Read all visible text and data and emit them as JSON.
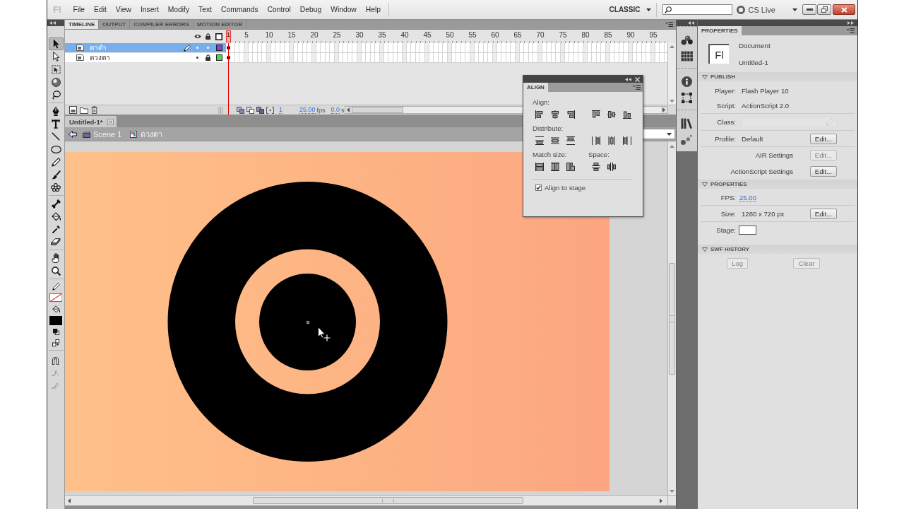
{
  "menu_bar": {
    "logo": "Fl",
    "items": [
      "File",
      "Edit",
      "View",
      "Insert",
      "Modify",
      "Text",
      "Commands",
      "Control",
      "Debug",
      "Window",
      "Help"
    ],
    "workspace": "CLASSIC",
    "cs_live": "CS Live"
  },
  "toolbar": {
    "tools": [
      {
        "kind": "selection",
        "selected": true
      },
      {
        "kind": "subselection",
        "selected": false
      },
      {
        "kind": "transform",
        "selected": false
      },
      {
        "kind": "rotation",
        "selected": false
      },
      {
        "kind": "lasso",
        "selected": false
      },
      {
        "kind": "pen",
        "selected": false
      },
      {
        "kind": "text",
        "selected": false
      },
      {
        "kind": "line",
        "selected": false
      },
      {
        "kind": "oval",
        "selected": false
      },
      {
        "kind": "pencil",
        "selected": false
      },
      {
        "kind": "brush",
        "selected": false
      },
      {
        "kind": "deco",
        "selected": false
      },
      {
        "kind": "bone",
        "selected": false
      },
      {
        "kind": "bucket",
        "selected": false
      },
      {
        "kind": "eyedropper",
        "selected": false
      },
      {
        "kind": "eraser",
        "selected": false
      },
      {
        "kind": "hand",
        "selected": false
      },
      {
        "kind": "zoom",
        "selected": false
      }
    ]
  },
  "timeline": {
    "tabs": [
      {
        "label": "TIMELINE",
        "selected": true
      },
      {
        "label": "OUTPUT",
        "selected": false
      },
      {
        "label": "COMPILER ERRORS",
        "selected": false
      },
      {
        "label": "MOTION EDITOR",
        "selected": false
      }
    ],
    "playhead_frame": "1",
    "frame_numbers": [
      "5",
      "10",
      "15",
      "20",
      "25",
      "30",
      "35",
      "40",
      "45",
      "50",
      "55",
      "60",
      "65",
      "70",
      "75",
      "80",
      "85",
      "90",
      "95"
    ],
    "layers": [
      {
        "name": "ตาดำ",
        "selected": true,
        "editing": true,
        "locked": false,
        "color": "#8b3fd0"
      },
      {
        "name": "ดวงตา",
        "selected": false,
        "editing": false,
        "locked": true,
        "color": "#40e040"
      }
    ],
    "current_frame": "1",
    "frame_rate": "25.00",
    "frame_rate_unit": "fps",
    "elapsed_time": "0.0",
    "elapsed_time_unit": "s"
  },
  "document": {
    "tab": "Untitled-1*",
    "scene": "Scene 1",
    "symbol": "ดวงตา"
  },
  "align_panel": {
    "title": "ALIGN",
    "groups": [
      {
        "label": "Align:"
      },
      {
        "label": "Distribute:"
      },
      {
        "label": "Match size:"
      },
      {
        "label": "Space:"
      }
    ],
    "align_to_stage": {
      "label": "Align to stage",
      "checked": true
    }
  },
  "properties_panel": {
    "tab": "PROPERTIES",
    "document_icon": "Fl",
    "document_type": "Document",
    "document_name": "Untitled-1",
    "sections": [
      {
        "title": "PUBLISH",
        "expanded": true,
        "rows": [
          {
            "kind": "value",
            "label": "Player:",
            "value": "Flash Player 10"
          },
          {
            "kind": "value",
            "label": "Script:",
            "value": "ActionScript 2.0"
          },
          {
            "kind": "field",
            "label": "Class:"
          },
          {
            "kind": "value",
            "label": "Profile:",
            "value": "Default",
            "button": {
              "label": "Edit...",
              "disabled": false
            }
          },
          {
            "kind": "setting",
            "label": "AIR Settings",
            "button": {
              "label": "Edit...",
              "disabled": true
            }
          },
          {
            "kind": "setting",
            "label": "ActionScript Settings",
            "button": {
              "label": "Edit...",
              "disabled": false
            }
          }
        ]
      },
      {
        "title": "PROPERTIES",
        "expanded": true,
        "rows": [
          {
            "kind": "link",
            "label": "FPS:",
            "value": "25.00"
          },
          {
            "kind": "value",
            "label": "Size:",
            "value": "1280 x 720 px",
            "button": {
              "label": "Edit...",
              "disabled": false
            }
          },
          {
            "kind": "swatch",
            "label": "Stage:"
          }
        ]
      },
      {
        "title": "SWF HISTORY",
        "expanded": true,
        "rows": [
          {
            "kind": "buttons",
            "buttons": [
              {
                "label": "Log",
                "disabled": true
              },
              {
                "label": "Clear",
                "disabled": true
              }
            ]
          }
        ]
      }
    ]
  }
}
